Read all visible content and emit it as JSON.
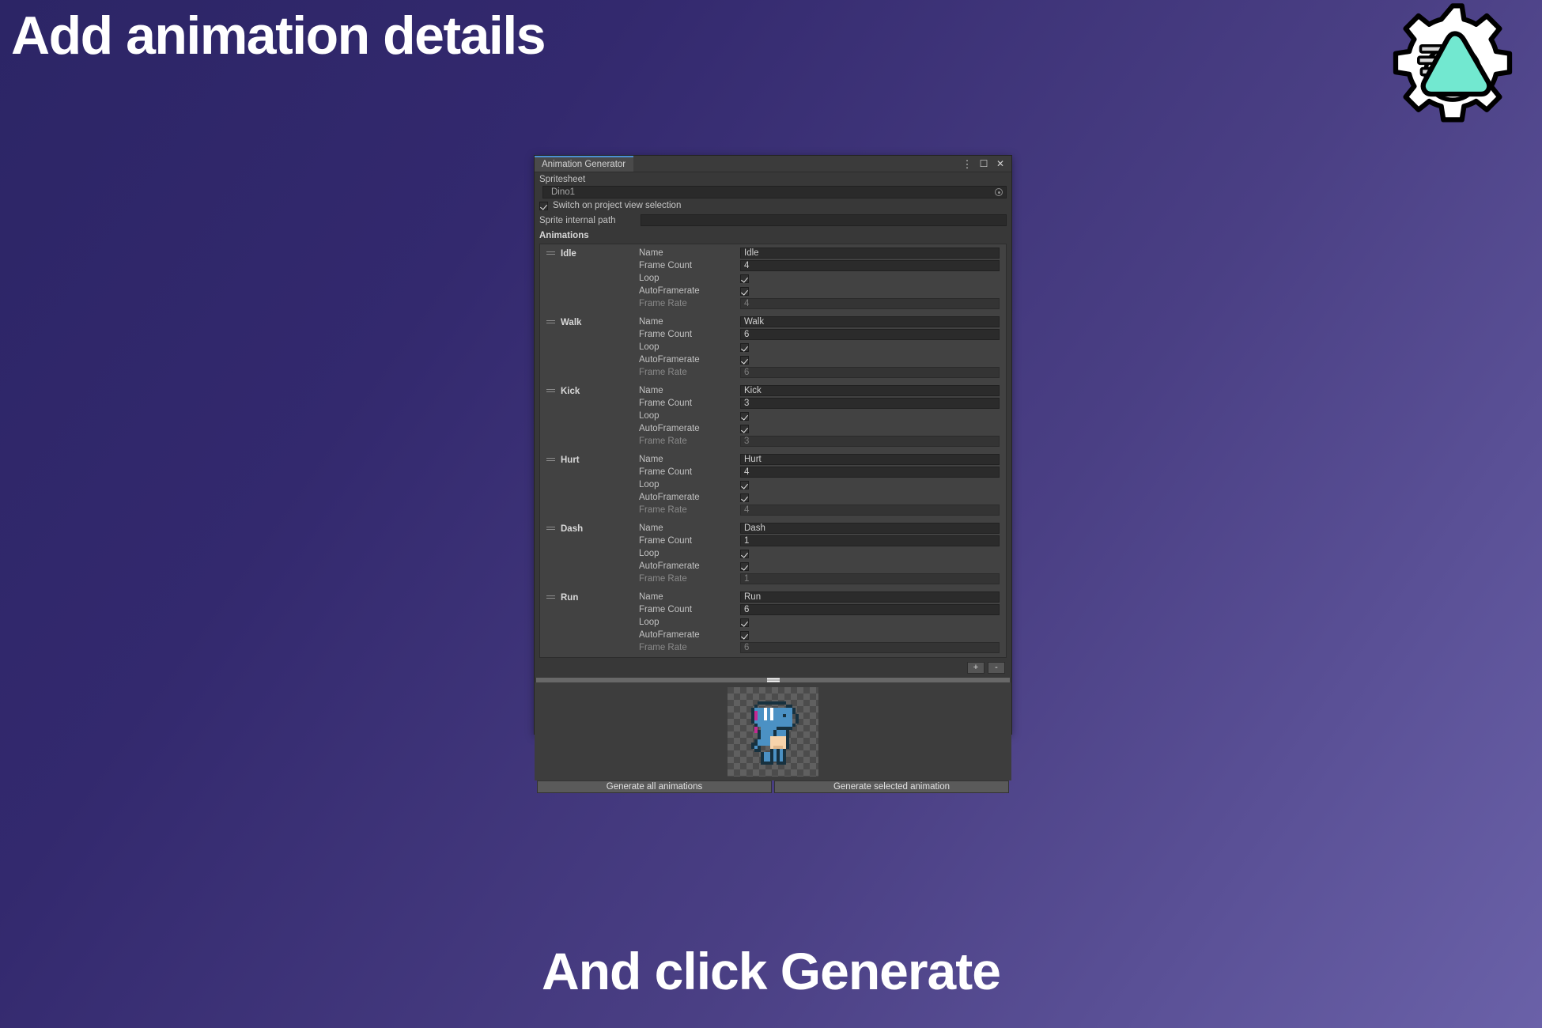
{
  "slide": {
    "title": "Add animation details",
    "caption": "And click Generate",
    "logo_icon": "gear-play-logo"
  },
  "window": {
    "tab_label": "Animation Generator",
    "controls": {
      "menu_icon": "kebab-menu-icon",
      "maximize_icon": "maximize-icon",
      "close_icon": "close-icon"
    },
    "spritesheet": {
      "label": "Spritesheet",
      "value": "Dino1",
      "picker_icon": "object-picker-icon"
    },
    "switch_on_selection": {
      "label": "Switch on project view selection",
      "checked": true
    },
    "sprite_internal_path": {
      "label": "Sprite internal path",
      "value": "",
      "placeholder": ""
    },
    "animations_header": "Animations",
    "field_labels": {
      "name": "Name",
      "frame_count": "Frame Count",
      "loop": "Loop",
      "auto_framerate": "AutoFramerate",
      "frame_rate": "Frame Rate"
    },
    "animations": [
      {
        "title": "Idle",
        "name": "Idle",
        "frame_count": "4",
        "loop": true,
        "auto_framerate": true,
        "frame_rate": "4"
      },
      {
        "title": "Walk",
        "name": "Walk",
        "frame_count": "6",
        "loop": true,
        "auto_framerate": true,
        "frame_rate": "6"
      },
      {
        "title": "Kick",
        "name": "Kick",
        "frame_count": "3",
        "loop": true,
        "auto_framerate": true,
        "frame_rate": "3"
      },
      {
        "title": "Hurt",
        "name": "Hurt",
        "frame_count": "4",
        "loop": true,
        "auto_framerate": true,
        "frame_rate": "4"
      },
      {
        "title": "Dash",
        "name": "Dash",
        "frame_count": "1",
        "loop": true,
        "auto_framerate": true,
        "frame_rate": "1"
      },
      {
        "title": "Run",
        "name": "Run",
        "frame_count": "6",
        "loop": true,
        "auto_framerate": true,
        "frame_rate": "6"
      }
    ],
    "list_toolbar": {
      "add_label": "+",
      "remove_label": "-"
    },
    "preview": {
      "sprite_name": "dino-sprite-preview"
    },
    "buttons": {
      "generate_all": "Generate all animations",
      "generate_selected": "Generate selected animation"
    }
  },
  "colors": {
    "bg_start": "#2c2566",
    "bg_end": "#6a61a8",
    "tab_accent": "#4b8fd4",
    "logo_triangle": "#72e8d0",
    "sprite_body": "#4b91c4",
    "sprite_outline": "#17313f",
    "sprite_belly": "#f6d3ab",
    "sprite_accent": "#c42a93"
  }
}
